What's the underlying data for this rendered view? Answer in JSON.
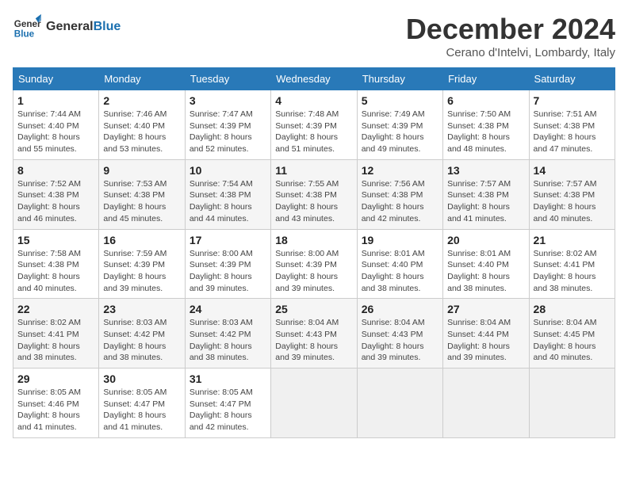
{
  "header": {
    "logo_text_general": "General",
    "logo_text_blue": "Blue",
    "month": "December 2024",
    "location": "Cerano d'Intelvi, Lombardy, Italy"
  },
  "weekdays": [
    "Sunday",
    "Monday",
    "Tuesday",
    "Wednesday",
    "Thursday",
    "Friday",
    "Saturday"
  ],
  "weeks": [
    [
      {
        "day": "1",
        "sunrise": "7:44 AM",
        "sunset": "4:40 PM",
        "daylight": "8 hours and 55 minutes."
      },
      {
        "day": "2",
        "sunrise": "7:46 AM",
        "sunset": "4:40 PM",
        "daylight": "8 hours and 53 minutes."
      },
      {
        "day": "3",
        "sunrise": "7:47 AM",
        "sunset": "4:39 PM",
        "daylight": "8 hours and 52 minutes."
      },
      {
        "day": "4",
        "sunrise": "7:48 AM",
        "sunset": "4:39 PM",
        "daylight": "8 hours and 51 minutes."
      },
      {
        "day": "5",
        "sunrise": "7:49 AM",
        "sunset": "4:39 PM",
        "daylight": "8 hours and 49 minutes."
      },
      {
        "day": "6",
        "sunrise": "7:50 AM",
        "sunset": "4:38 PM",
        "daylight": "8 hours and 48 minutes."
      },
      {
        "day": "7",
        "sunrise": "7:51 AM",
        "sunset": "4:38 PM",
        "daylight": "8 hours and 47 minutes."
      }
    ],
    [
      {
        "day": "8",
        "sunrise": "7:52 AM",
        "sunset": "4:38 PM",
        "daylight": "8 hours and 46 minutes."
      },
      {
        "day": "9",
        "sunrise": "7:53 AM",
        "sunset": "4:38 PM",
        "daylight": "8 hours and 45 minutes."
      },
      {
        "day": "10",
        "sunrise": "7:54 AM",
        "sunset": "4:38 PM",
        "daylight": "8 hours and 44 minutes."
      },
      {
        "day": "11",
        "sunrise": "7:55 AM",
        "sunset": "4:38 PM",
        "daylight": "8 hours and 43 minutes."
      },
      {
        "day": "12",
        "sunrise": "7:56 AM",
        "sunset": "4:38 PM",
        "daylight": "8 hours and 42 minutes."
      },
      {
        "day": "13",
        "sunrise": "7:57 AM",
        "sunset": "4:38 PM",
        "daylight": "8 hours and 41 minutes."
      },
      {
        "day": "14",
        "sunrise": "7:57 AM",
        "sunset": "4:38 PM",
        "daylight": "8 hours and 40 minutes."
      }
    ],
    [
      {
        "day": "15",
        "sunrise": "7:58 AM",
        "sunset": "4:38 PM",
        "daylight": "8 hours and 40 minutes."
      },
      {
        "day": "16",
        "sunrise": "7:59 AM",
        "sunset": "4:39 PM",
        "daylight": "8 hours and 39 minutes."
      },
      {
        "day": "17",
        "sunrise": "8:00 AM",
        "sunset": "4:39 PM",
        "daylight": "8 hours and 39 minutes."
      },
      {
        "day": "18",
        "sunrise": "8:00 AM",
        "sunset": "4:39 PM",
        "daylight": "8 hours and 39 minutes."
      },
      {
        "day": "19",
        "sunrise": "8:01 AM",
        "sunset": "4:40 PM",
        "daylight": "8 hours and 38 minutes."
      },
      {
        "day": "20",
        "sunrise": "8:01 AM",
        "sunset": "4:40 PM",
        "daylight": "8 hours and 38 minutes."
      },
      {
        "day": "21",
        "sunrise": "8:02 AM",
        "sunset": "4:41 PM",
        "daylight": "8 hours and 38 minutes."
      }
    ],
    [
      {
        "day": "22",
        "sunrise": "8:02 AM",
        "sunset": "4:41 PM",
        "daylight": "8 hours and 38 minutes."
      },
      {
        "day": "23",
        "sunrise": "8:03 AM",
        "sunset": "4:42 PM",
        "daylight": "8 hours and 38 minutes."
      },
      {
        "day": "24",
        "sunrise": "8:03 AM",
        "sunset": "4:42 PM",
        "daylight": "8 hours and 38 minutes."
      },
      {
        "day": "25",
        "sunrise": "8:04 AM",
        "sunset": "4:43 PM",
        "daylight": "8 hours and 39 minutes."
      },
      {
        "day": "26",
        "sunrise": "8:04 AM",
        "sunset": "4:43 PM",
        "daylight": "8 hours and 39 minutes."
      },
      {
        "day": "27",
        "sunrise": "8:04 AM",
        "sunset": "4:44 PM",
        "daylight": "8 hours and 39 minutes."
      },
      {
        "day": "28",
        "sunrise": "8:04 AM",
        "sunset": "4:45 PM",
        "daylight": "8 hours and 40 minutes."
      }
    ],
    [
      {
        "day": "29",
        "sunrise": "8:05 AM",
        "sunset": "4:46 PM",
        "daylight": "8 hours and 41 minutes."
      },
      {
        "day": "30",
        "sunrise": "8:05 AM",
        "sunset": "4:47 PM",
        "daylight": "8 hours and 41 minutes."
      },
      {
        "day": "31",
        "sunrise": "8:05 AM",
        "sunset": "4:47 PM",
        "daylight": "8 hours and 42 minutes."
      },
      null,
      null,
      null,
      null
    ]
  ]
}
